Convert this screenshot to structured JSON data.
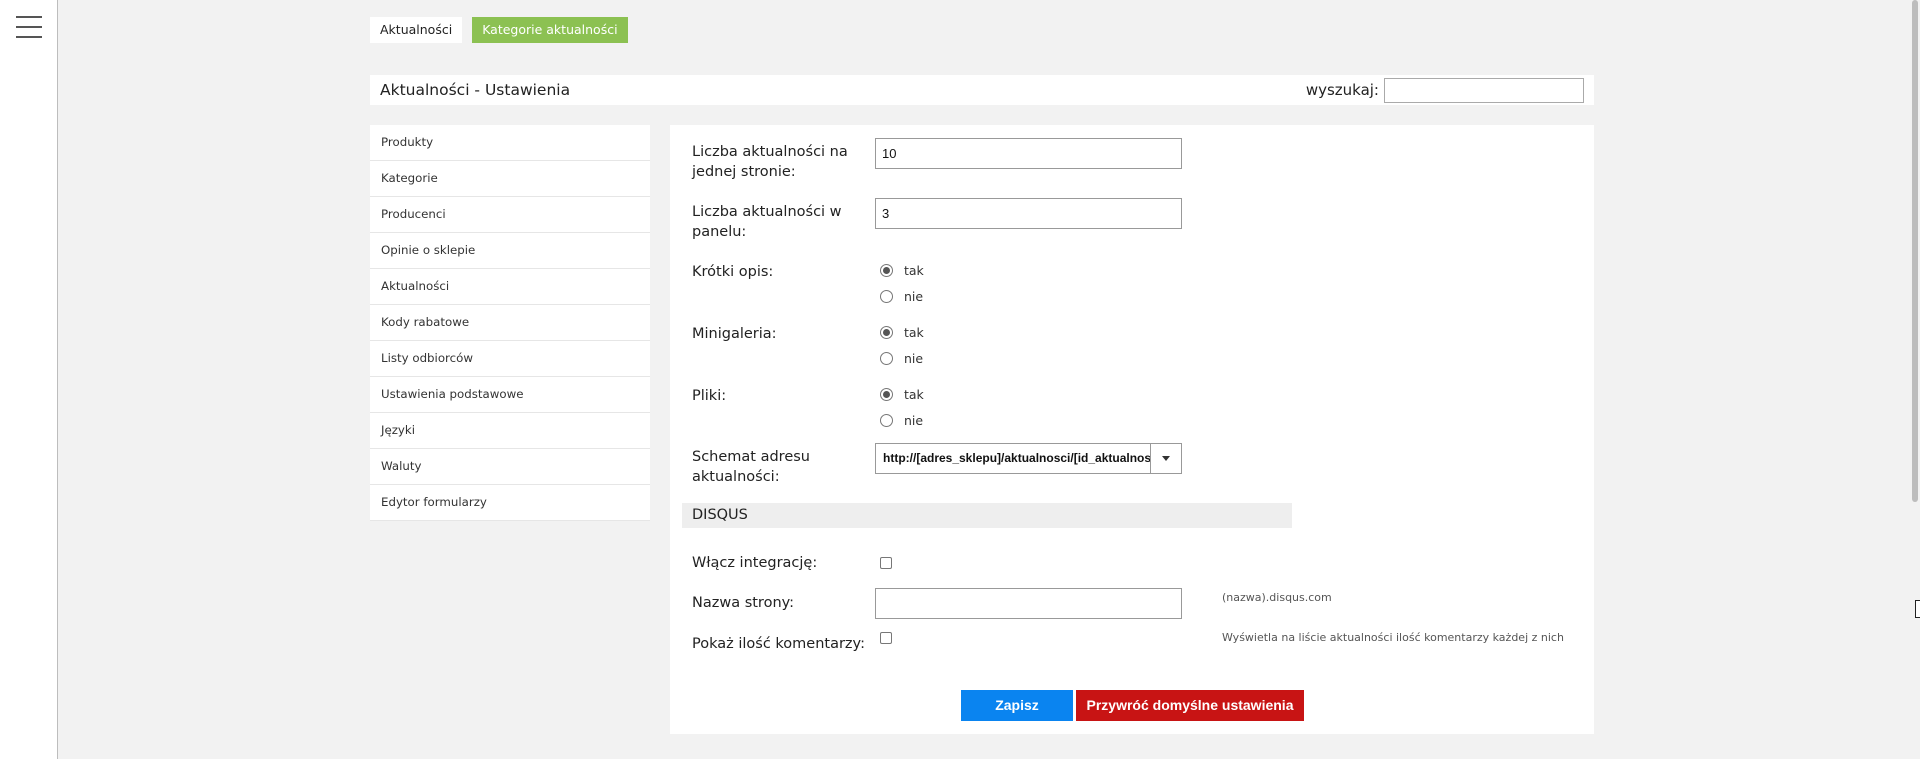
{
  "tabs": [
    {
      "label": "Aktualności"
    },
    {
      "label": "Kategorie aktualności"
    }
  ],
  "header": {
    "title": "Aktualności - Ustawienia",
    "search_label": "wyszukaj:",
    "search_value": ""
  },
  "sidebar": {
    "items": [
      {
        "label": "Produkty"
      },
      {
        "label": "Kategorie"
      },
      {
        "label": "Producenci"
      },
      {
        "label": "Opinie o sklepie"
      },
      {
        "label": "Aktualności"
      },
      {
        "label": "Kody rabatowe"
      },
      {
        "label": "Listy odbiorców"
      },
      {
        "label": "Ustawienia podstawowe"
      },
      {
        "label": "Języki"
      },
      {
        "label": "Waluty"
      },
      {
        "label": "Edytor formularzy"
      }
    ]
  },
  "form": {
    "per_page": {
      "label_line1": "Liczba aktualności na",
      "label_line2": "jednej stronie:",
      "value": "10"
    },
    "per_panel": {
      "label_line1": "Liczba aktualności w",
      "label_line2": "panelu:",
      "value": "3"
    },
    "short_desc": {
      "label": "Krótki opis:",
      "selected": "tak",
      "options": [
        "tak",
        "nie"
      ]
    },
    "minigallery": {
      "label": "Minigaleria:",
      "selected": "tak",
      "options": [
        "tak",
        "nie"
      ]
    },
    "files": {
      "label": "Pliki:",
      "selected": "tak",
      "options": [
        "tak",
        "nie"
      ]
    },
    "url_scheme": {
      "label_line1": "Schemat adresu",
      "label_line2": "aktualności:",
      "value": "http://[adres_sklepu]/aktualnosci/[id_aktualnosci]"
    }
  },
  "disqus": {
    "section_title": "DISQUS",
    "enable": {
      "label": "Włącz integrację:",
      "checked": false
    },
    "site_name": {
      "label": "Nazwa strony:",
      "value": "",
      "hint": "(nazwa).disqus.com"
    },
    "show_count": {
      "label": "Pokaż ilość komentarzy:",
      "checked": false,
      "hint": "Wyświetla na liście aktualności ilość komentarzy każdej z nich"
    }
  },
  "buttons": {
    "save": "Zapisz",
    "restore": "Przywróć domyślne ustawienia"
  },
  "colors": {
    "green_tab": "#8cc152",
    "save_button": "#0a84f0",
    "restore_button": "#c81414"
  }
}
